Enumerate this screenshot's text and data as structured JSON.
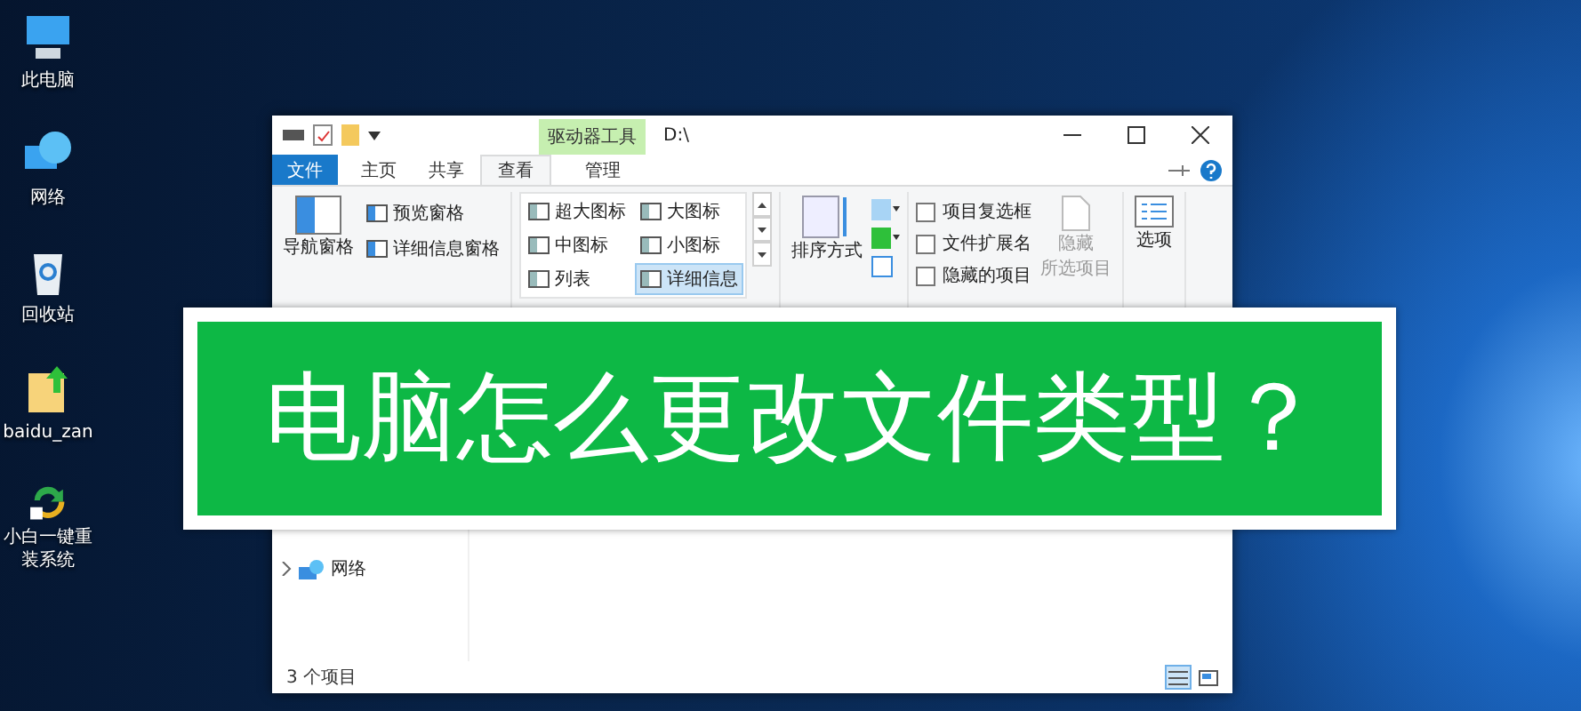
{
  "desktop_icons": [
    {
      "label": "此电脑",
      "kind": "computer"
    },
    {
      "label": "网络",
      "kind": "network"
    },
    {
      "label": "回收站",
      "kind": "recycle"
    },
    {
      "label": "baidu_zan",
      "kind": "file"
    },
    {
      "label": "小白一键重装系统",
      "kind": "app"
    }
  ],
  "window": {
    "context_tab": "驱动器工具",
    "title": "D:\\",
    "tabs": [
      {
        "label": "文件",
        "kind": "file",
        "selected": false
      },
      {
        "label": "主页",
        "kind": "normal",
        "selected": false
      },
      {
        "label": "共享",
        "kind": "normal",
        "selected": false
      },
      {
        "label": "查看",
        "kind": "normal",
        "selected": true
      },
      {
        "label": "管理",
        "kind": "context",
        "selected": false
      }
    ],
    "panes": [
      {
        "label": "导航窗格",
        "kind": "large"
      },
      {
        "label": "预览窗格",
        "kind": "small"
      },
      {
        "label": "详细信息窗格",
        "kind": "small"
      }
    ],
    "layouts": [
      {
        "label": "超大图标",
        "selected": false
      },
      {
        "label": "大图标",
        "selected": false
      },
      {
        "label": "中图标",
        "selected": false
      },
      {
        "label": "小图标",
        "selected": false
      },
      {
        "label": "列表",
        "selected": false
      },
      {
        "label": "详细信息",
        "selected": true
      }
    ],
    "sort_label": "排序方式",
    "checkboxes": [
      {
        "label": "项目复选框",
        "checked": false
      },
      {
        "label": "文件扩展名",
        "checked": false
      },
      {
        "label": "隐藏的项目",
        "checked": false
      }
    ],
    "hide_button": {
      "lines": [
        "隐藏",
        "所选项目"
      ],
      "disabled": true
    },
    "options_label": "选项",
    "nav": [
      {
        "label": "网络",
        "expanded": false
      }
    ],
    "status": "3 个项目"
  },
  "banner": "电脑怎么更改文件类型？"
}
